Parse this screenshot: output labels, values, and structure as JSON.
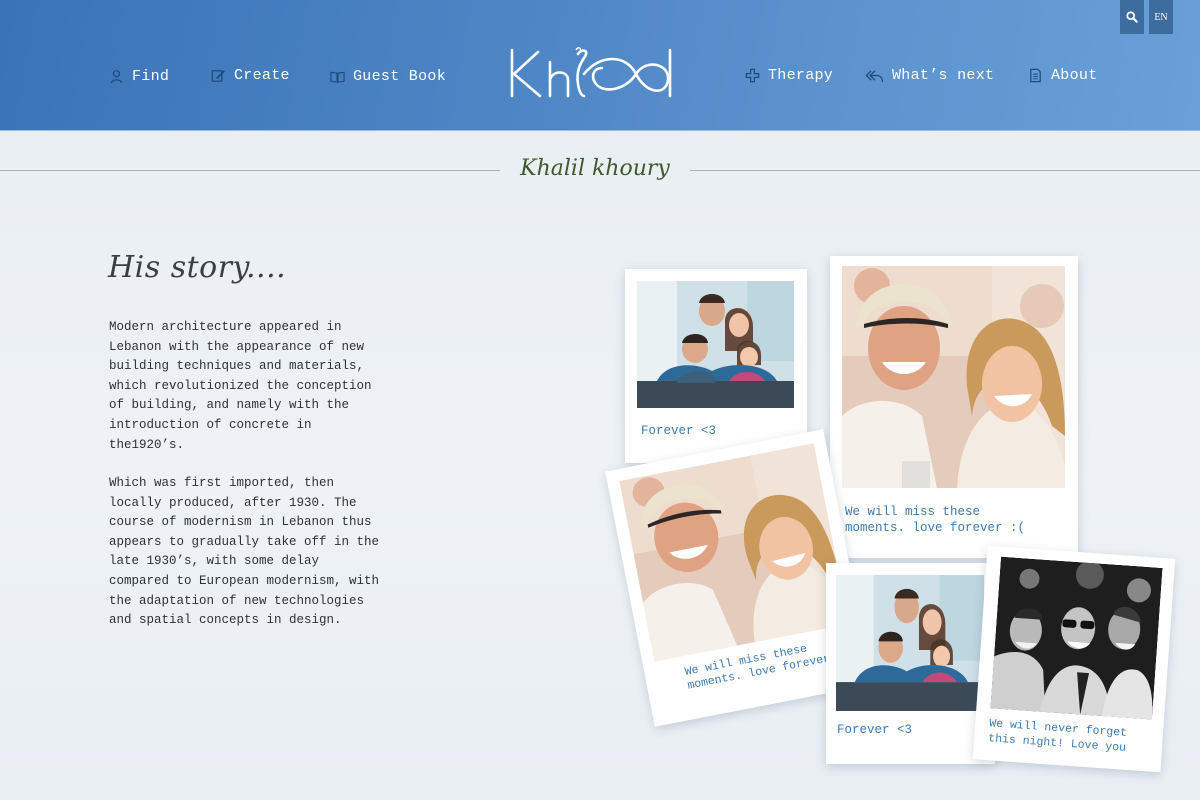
{
  "nav": {
    "left": [
      {
        "label": "Find",
        "icon": "person-icon"
      },
      {
        "label": "Create",
        "icon": "edit-icon"
      },
      {
        "label": "Guest Book",
        "icon": "book-icon"
      }
    ],
    "right": [
      {
        "label": "Therapy",
        "icon": "plus-icon"
      },
      {
        "label": "What’s next",
        "icon": "reply-all-icon"
      },
      {
        "label": "About",
        "icon": "document-icon"
      }
    ],
    "logo_text": "Khlood",
    "search_icon": "search-icon",
    "language": "EN"
  },
  "colors": {
    "header_blue": "#3a74b8",
    "caption_blue": "#3d7bb3",
    "name_green": "#3d5a2c"
  },
  "person": {
    "name": "Khalil khoury"
  },
  "story": {
    "heading": "His story....",
    "paragraph1": "Modern architecture appeared in\nLebanon with the appearance of new\nbuilding techniques and materials,\nwhich revolutionized the conception\nof building, and namely with the\nintroduction of concrete in\nthe1920’s.",
    "paragraph2": "Which was first imported, then\nlocally produced, after 1930. The\ncourse of modernism in Lebanon thus\nappears to gradually take off in the\nlate 1930’s, with some delay\ncompared to European modernism, with\nthe adaptation of new technologies\nand spatial concepts in design."
  },
  "gallery": [
    {
      "caption": "Forever <3"
    },
    {
      "caption": "We will miss these\nmoments. love forever :("
    },
    {
      "caption": "We will miss these\nmoments. love forever :("
    },
    {
      "caption": "Forever <3"
    },
    {
      "caption": "We will never forget\nthis night! Love you"
    }
  ]
}
